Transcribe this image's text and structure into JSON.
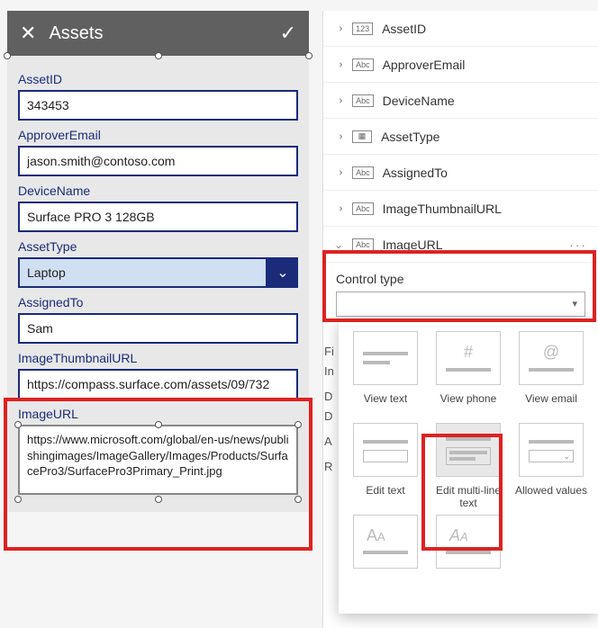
{
  "header": {
    "title": "Assets"
  },
  "form": {
    "assetId_label": "AssetID",
    "assetId_value": "343453",
    "approverEmail_label": "ApproverEmail",
    "approverEmail_value": "jason.smith@contoso.com",
    "deviceName_label": "DeviceName",
    "deviceName_value": "Surface PRO 3 128GB",
    "assetType_label": "AssetType",
    "assetType_value": "Laptop",
    "assignedTo_label": "AssignedTo",
    "assignedTo_value": "Sam",
    "thumb_label": "ImageThumbnailURL",
    "thumb_value": "https://compass.surface.com/assets/09/732",
    "imageUrl_label": "ImageURL",
    "imageUrl_value": "https://www.microsoft.com/global/en-us/news/publishingimages/ImageGallery/Images/Products/SurfacePro3/SurfacePro3Primary_Print.jpg"
  },
  "props": {
    "items": [
      {
        "icon": "123",
        "label": "AssetID"
      },
      {
        "icon": "Abc",
        "label": "ApproverEmail"
      },
      {
        "icon": "Abc",
        "label": "DeviceName"
      },
      {
        "icon": "grid",
        "label": "AssetType"
      },
      {
        "icon": "Abc",
        "label": "AssignedTo"
      },
      {
        "icon": "Abc",
        "label": "ImageThumbnailURL"
      },
      {
        "icon": "Abc",
        "label": "ImageURL"
      }
    ],
    "controlType_label": "Control type"
  },
  "sideLabels": [
    "Fi",
    "In",
    "D",
    "D",
    "A",
    "R"
  ],
  "tiles": {
    "r1": [
      "View text",
      "View phone",
      "View email"
    ],
    "r2": [
      "Edit text",
      "Edit multi-line text",
      "Allowed values"
    ]
  }
}
